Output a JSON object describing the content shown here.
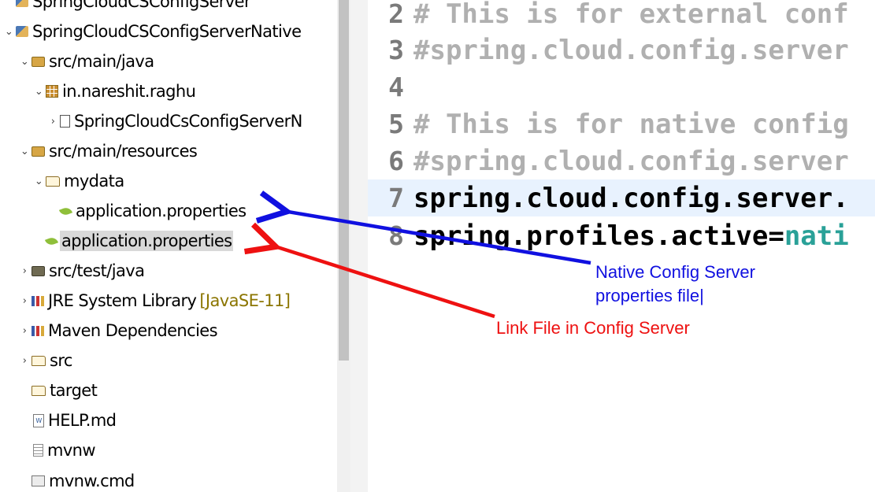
{
  "explorer": {
    "items": [
      {
        "label": "SpringCloudCSConfigServer",
        "decoration": "",
        "twisty": "",
        "icon": "project-icon"
      },
      {
        "label": "SpringCloudCSConfigServerNative",
        "decoration": "",
        "twisty": "⌄",
        "icon": "project-icon"
      },
      {
        "label": "src/main/java",
        "decoration": "",
        "twisty": "⌄",
        "icon": "source-folder-icon"
      },
      {
        "label": "in.nareshit.raghu",
        "decoration": "",
        "twisty": "⌄",
        "icon": "package-icon"
      },
      {
        "label": "SpringCloudCsConfigServerN",
        "decoration": "",
        "twisty": "›",
        "icon": "java-file-icon"
      },
      {
        "label": "src/main/resources",
        "decoration": "",
        "twisty": "⌄",
        "icon": "source-folder-icon"
      },
      {
        "label": "mydata",
        "decoration": "",
        "twisty": "⌄",
        "icon": "folder-open-icon"
      },
      {
        "label": "application.properties",
        "decoration": "",
        "twisty": "",
        "icon": "properties-file-icon"
      },
      {
        "label": "application.properties",
        "decoration": "",
        "twisty": "",
        "icon": "properties-file-icon"
      },
      {
        "label": "src/test/java",
        "decoration": "",
        "twisty": "›",
        "icon": "source-folder-icon"
      },
      {
        "label": "JRE System Library",
        "decoration": "[JavaSE-11]",
        "twisty": "›",
        "icon": "library-icon"
      },
      {
        "label": "Maven Dependencies",
        "decoration": "",
        "twisty": "›",
        "icon": "library-icon"
      },
      {
        "label": "src",
        "decoration": "",
        "twisty": "›",
        "icon": "folder-icon"
      },
      {
        "label": "target",
        "decoration": "",
        "twisty": "",
        "icon": "folder-icon"
      },
      {
        "label": "HELP.md",
        "decoration": "",
        "twisty": "",
        "icon": "markdown-file-icon"
      },
      {
        "label": "mvnw",
        "decoration": "",
        "twisty": "",
        "icon": "text-file-icon"
      },
      {
        "label": "mvnw.cmd",
        "decoration": "",
        "twisty": "",
        "icon": "cmd-file-icon"
      }
    ]
  },
  "editor": {
    "lines": [
      {
        "number": "2",
        "text": "# This is for external conf"
      },
      {
        "number": "3",
        "text": "#spring.cloud.config.server"
      },
      {
        "number": "4",
        "text": ""
      },
      {
        "number": "5",
        "text": "# This is for native config"
      },
      {
        "number": "6",
        "text": "#spring.cloud.config.server"
      },
      {
        "number": "7",
        "text": "spring.cloud.config.server."
      },
      {
        "number": "8",
        "key": "spring.profiles.active=",
        "value": "nati"
      }
    ]
  },
  "annotations": {
    "native_line1": "Native Config Server",
    "native_line2": "properties file|",
    "link": "Link File in Config Server",
    "colors": {
      "native": "#1010e0",
      "link": "#ee1111"
    }
  }
}
